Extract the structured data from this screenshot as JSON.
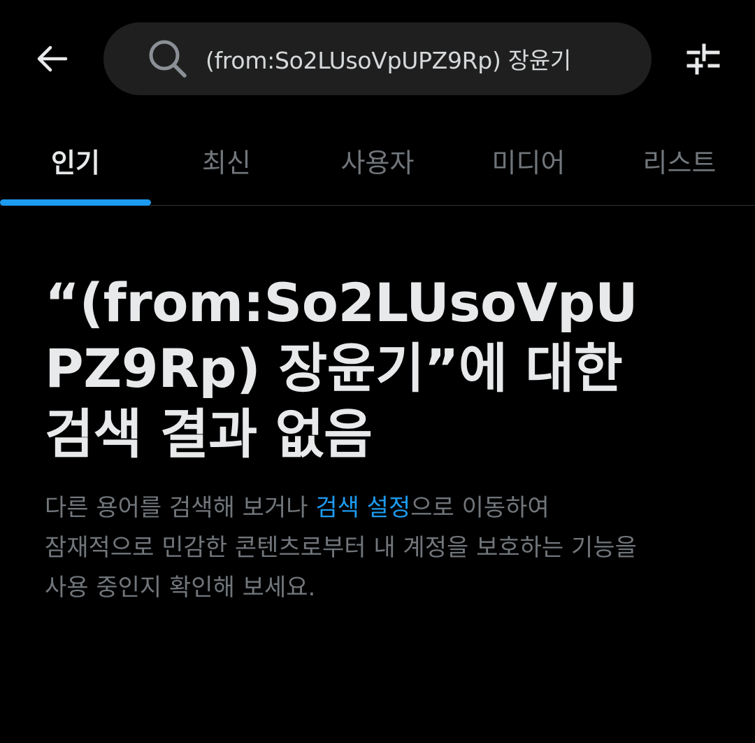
{
  "header": {
    "back_icon": "arrow-left-icon",
    "search_icon": "search-icon",
    "search_query": "(from:So2LUsoVpUPZ9Rp) 장윤기",
    "filter_icon": "sliders-icon"
  },
  "tabs": [
    {
      "label": "인기",
      "active": true
    },
    {
      "label": "최신",
      "active": false
    },
    {
      "label": "사용자",
      "active": false
    },
    {
      "label": "미디어",
      "active": false
    },
    {
      "label": "리스트",
      "active": false
    }
  ],
  "empty_state": {
    "headline_line1": "“(from:So2LUsoVpU",
    "headline_line2": "PZ9Rp) 장윤기”에 대한",
    "headline_line3": "검색 결과 없음",
    "desc_before_link": "다른 용어를 검색해 보거나 ",
    "desc_link": "검색 설정",
    "desc_after_link": "으로 이동하여",
    "desc_line2": "잠재적으로 민감한 콘텐츠로부터 내 계정을 보호하는 기능을",
    "desc_line3": "사용 중인지 확인해 보세요."
  },
  "colors": {
    "background": "#000000",
    "primary_text": "#e7e9ea",
    "secondary_text": "#71767b",
    "accent": "#1d9bf0",
    "search_bg": "#1f1f1f"
  }
}
